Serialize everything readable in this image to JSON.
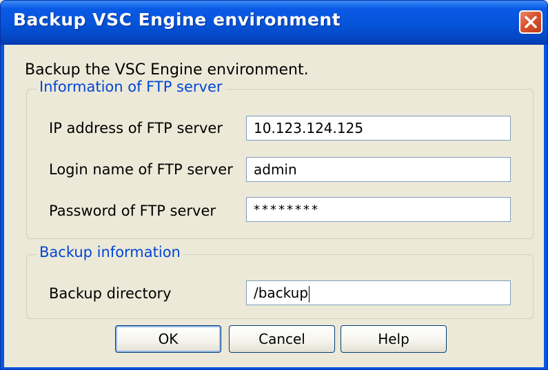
{
  "window": {
    "title": "Backup VSC Engine environment"
  },
  "description": "Backup the VSC Engine environment.",
  "ftp_group": {
    "title": "Information of FTP server",
    "ip_label": "IP address of FTP server",
    "ip_value": "10.123.124.125",
    "login_label": "Login name of FTP server",
    "login_value": "admin",
    "password_label": "Password of FTP server",
    "password_value": "********"
  },
  "backup_group": {
    "title": "Backup information",
    "directory_label": "Backup directory",
    "directory_value": "/backup"
  },
  "buttons": {
    "ok": "OK",
    "cancel": "Cancel",
    "help": "Help"
  },
  "colors": {
    "titlebar": "#0553d8",
    "group_title": "#0046d5",
    "close_button": "#d9532f",
    "dialog_background": "#ece9d8"
  }
}
